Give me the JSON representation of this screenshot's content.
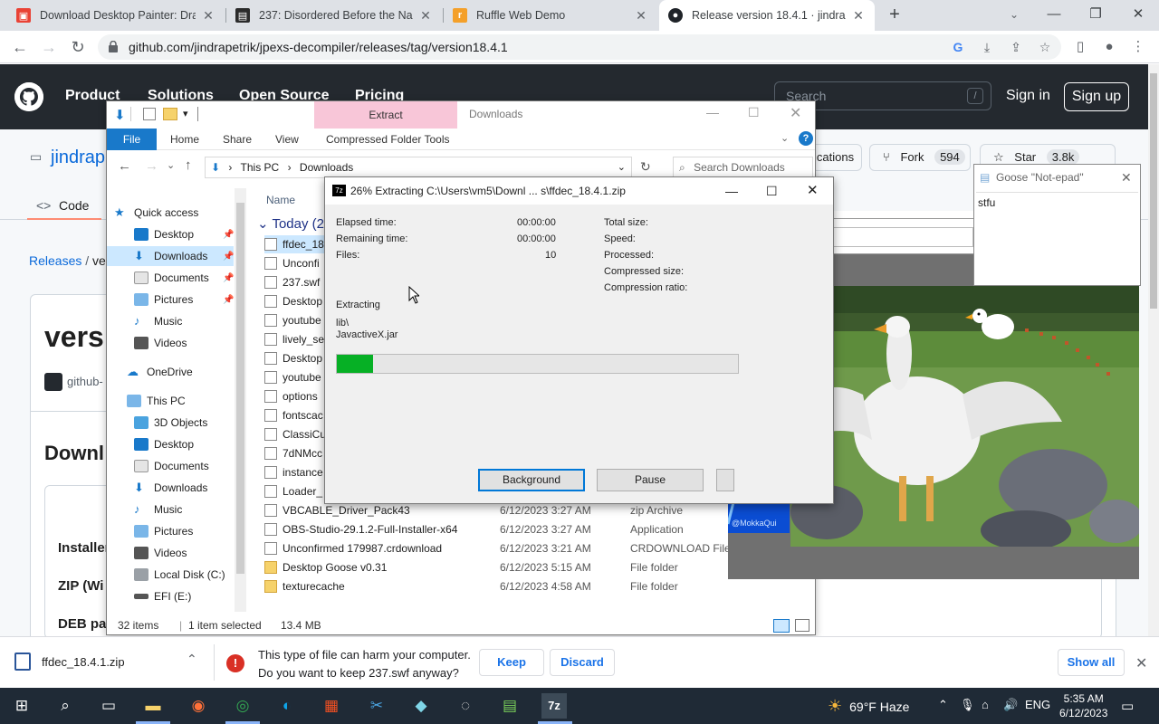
{
  "browser": {
    "tabs": [
      {
        "title": "Download Desktop Painter: Draw",
        "favicon_color": "#e94235"
      },
      {
        "title": "237: Disordered Before the Nake",
        "favicon_color": "#2b2b2b"
      },
      {
        "title": "Ruffle Web Demo",
        "favicon_color": "#f4a02a"
      },
      {
        "title": "Release version 18.4.1 · jindrapetr",
        "favicon_color": "#1f2328"
      }
    ],
    "url": "github.com/jindrapetrik/jpexs-decompiler/releases/tag/version18.4.1"
  },
  "github": {
    "nav": [
      "Product",
      "Solutions",
      "Open Source",
      "Pricing"
    ],
    "search_placeholder": "Search",
    "search_key": "/",
    "signin": "Sign in",
    "signup": "Sign up",
    "repo_owner_partial": "jindrap",
    "notifications_partial": "ications",
    "fork_label": "Fork",
    "fork_count": "594",
    "star_label": "Star",
    "star_count": "3.8k",
    "code_tab": "Code",
    "breadcrumb_releases": "Releases",
    "breadcrumb_sep": "/",
    "breadcrumb_partial": "ver",
    "release_title_partial": "versi",
    "author_partial": "github-",
    "downloads_partial": "Downl",
    "asset_installer_partial": "Installer",
    "asset_zip_partial": "ZIP (Wi",
    "asset_deb_partial": "DEB pa"
  },
  "explorer": {
    "title": "Downloads",
    "ribbon_contextual_tab": "Extract",
    "ribbon_tabs": [
      "File",
      "Home",
      "Share",
      "View",
      "Compressed Folder Tools"
    ],
    "breadcrumb": [
      "This PC",
      "Downloads"
    ],
    "search_placeholder": "Search Downloads",
    "nav": [
      {
        "label": "Quick access",
        "icon": "star-icon",
        "pinned": false
      },
      {
        "label": "Desktop",
        "icon": "desktop-icon",
        "pinned": true
      },
      {
        "label": "Downloads",
        "icon": "download-arrow-icon",
        "pinned": true,
        "selected": true
      },
      {
        "label": "Documents",
        "icon": "documents-icon",
        "pinned": true
      },
      {
        "label": "Pictures",
        "icon": "pictures-icon",
        "pinned": true
      },
      {
        "label": "Music",
        "icon": "music-icon",
        "pinned": false
      },
      {
        "label": "Videos",
        "icon": "videos-icon",
        "pinned": false
      },
      {
        "label": "OneDrive",
        "icon": "cloud-icon",
        "pinned": false
      },
      {
        "label": "This PC",
        "icon": "computer-icon",
        "pinned": false
      },
      {
        "label": "3D Objects",
        "icon": "cube-icon",
        "pinned": false
      },
      {
        "label": "Desktop",
        "icon": "desktop-icon",
        "pinned": false
      },
      {
        "label": "Documents",
        "icon": "documents-icon",
        "pinned": false
      },
      {
        "label": "Downloads",
        "icon": "download-arrow-icon",
        "pinned": false
      },
      {
        "label": "Music",
        "icon": "music-icon",
        "pinned": false
      },
      {
        "label": "Pictures",
        "icon": "pictures-icon",
        "pinned": false
      },
      {
        "label": "Videos",
        "icon": "videos-icon",
        "pinned": false
      },
      {
        "label": "Local Disk (C:)",
        "icon": "drive-icon",
        "pinned": false
      },
      {
        "label": "EFI (E:)",
        "icon": "drive-icon",
        "pinned": false
      }
    ],
    "column_name": "Name",
    "group_label": "Today (25",
    "files": [
      {
        "name": "ffdec_18",
        "date": "",
        "type": "",
        "folder": false,
        "selected": true
      },
      {
        "name": "Unconfi",
        "date": "",
        "type": "",
        "folder": false
      },
      {
        "name": "237.swf",
        "date": "",
        "type": "",
        "folder": false
      },
      {
        "name": "Desktop",
        "date": "",
        "type": "",
        "folder": false
      },
      {
        "name": "youtube",
        "date": "",
        "type": "",
        "folder": false
      },
      {
        "name": "lively_se",
        "date": "",
        "type": "",
        "folder": false
      },
      {
        "name": "Desktop",
        "date": "",
        "type": "",
        "folder": false
      },
      {
        "name": "youtube",
        "date": "",
        "type": "",
        "folder": false
      },
      {
        "name": "options",
        "date": "",
        "type": "",
        "folder": false
      },
      {
        "name": "fontscac",
        "date": "",
        "type": "",
        "folder": false
      },
      {
        "name": "ClassiCu",
        "date": "",
        "type": "",
        "folder": false
      },
      {
        "name": "7dNMcc",
        "date": "",
        "type": "",
        "folder": false
      },
      {
        "name": "instance",
        "date": "",
        "type": "",
        "folder": false
      },
      {
        "name": "Loader_",
        "date": "",
        "type": "",
        "folder": false
      },
      {
        "name": "VBCABLE_Driver_Pack43",
        "date": "6/12/2023 3:27 AM",
        "type": "zip Archive",
        "folder": false
      },
      {
        "name": "OBS-Studio-29.1.2-Full-Installer-x64",
        "date": "6/12/2023 3:27 AM",
        "type": "Application",
        "folder": false
      },
      {
        "name": "Unconfirmed 179987.crdownload",
        "date": "6/12/2023 3:21 AM",
        "type": "CRDOWNLOAD File",
        "folder": false
      },
      {
        "name": "Desktop Goose v0.31",
        "date": "6/12/2023 5:15 AM",
        "type": "File folder",
        "folder": true
      },
      {
        "name": "texturecache",
        "date": "6/12/2023 4:58 AM",
        "type": "File folder",
        "folder": true
      }
    ],
    "status": {
      "items": "32 items",
      "selected": "1 item selected",
      "size": "13.4 MB"
    }
  },
  "zip": {
    "title": "26% Extracting C:\\Users\\vm5\\Downl ... s\\ffdec_18.4.1.zip",
    "elapsed_label": "Elapsed time:",
    "elapsed": "00:00:00",
    "remaining_label": "Remaining time:",
    "remaining": "00:00:00",
    "files_label": "Files:",
    "files": "10",
    "total_size_label": "Total size:",
    "speed_label": "Speed:",
    "processed_label": "Processed:",
    "compressed_label": "Compressed size:",
    "ratio_label": "Compression ratio:",
    "status": "Extracting",
    "path": "lib\\",
    "current_file": "JavactiveX.jar",
    "progress": 0.09,
    "background_btn": "Background",
    "pause_btn": "Pause"
  },
  "notepad": {
    "title": "Goose \"Not-epad\"",
    "text": "stfu"
  },
  "video": {
    "watermark": "@MokkaQui"
  },
  "download_bar": {
    "file": "ffdec_18.4.1.zip",
    "warning_line1": "This type of file can harm your computer.",
    "warning_line2": "Do you want to keep 237.swf anyway?",
    "keep": "Keep",
    "discard": "Discard",
    "show_all": "Show all"
  },
  "taskbar": {
    "weather": "69°F  Haze",
    "lang": "ENG",
    "time": "5:35 AM",
    "date": "6/12/2023"
  }
}
